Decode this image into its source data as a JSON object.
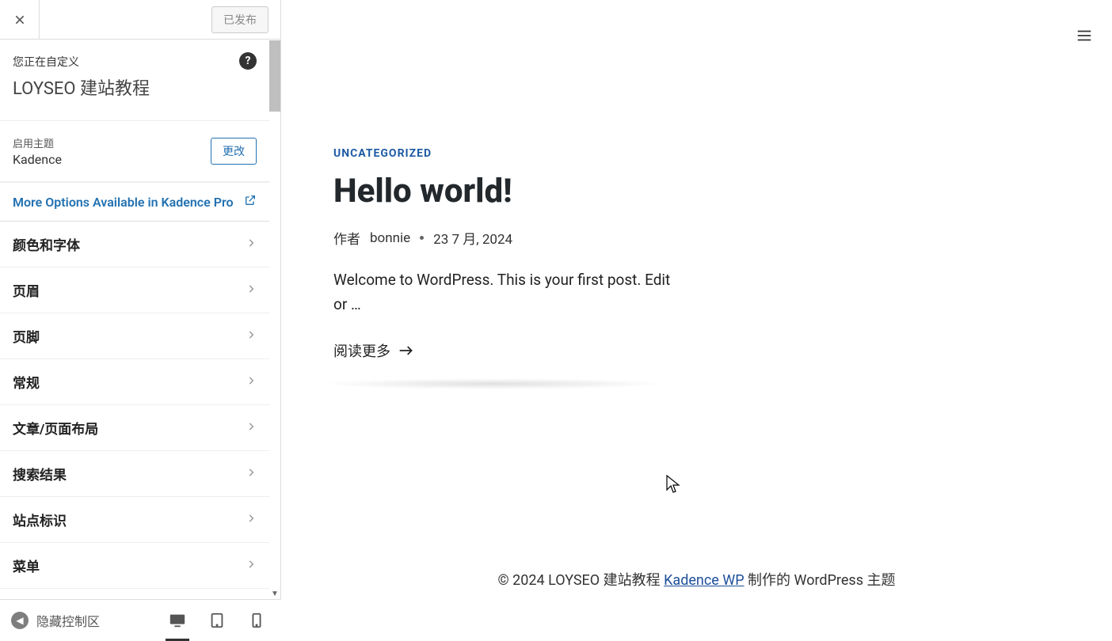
{
  "top": {
    "publish_label": "已发布"
  },
  "intro": {
    "small": "您正在自定义",
    "title": "LOYSEO 建站教程"
  },
  "theme": {
    "label": "启用主题",
    "name": "Kadence",
    "change_label": "更改"
  },
  "pro_banner": "More Options Available in Kadence Pro",
  "nav": {
    "items": [
      "颜色和字体",
      "页眉",
      "页脚",
      "常规",
      "文章/页面布局",
      "搜索结果",
      "站点标识",
      "菜单"
    ]
  },
  "footer": {
    "collapse_label": "隐藏控制区"
  },
  "post": {
    "category": "UNCATEGORIZED",
    "title": "Hello world!",
    "author_prefix": "作者",
    "author": "bonnie",
    "date": "23 7 月, 2024",
    "excerpt": "Welcome to WordPress. This is your first post. Edit or …",
    "readmore": "阅读更多"
  },
  "credit": {
    "prefix": "© 2024 LOYSEO 建站教程 ",
    "link": "Kadence WP",
    "suffix": " 制作的 WordPress 主题"
  }
}
